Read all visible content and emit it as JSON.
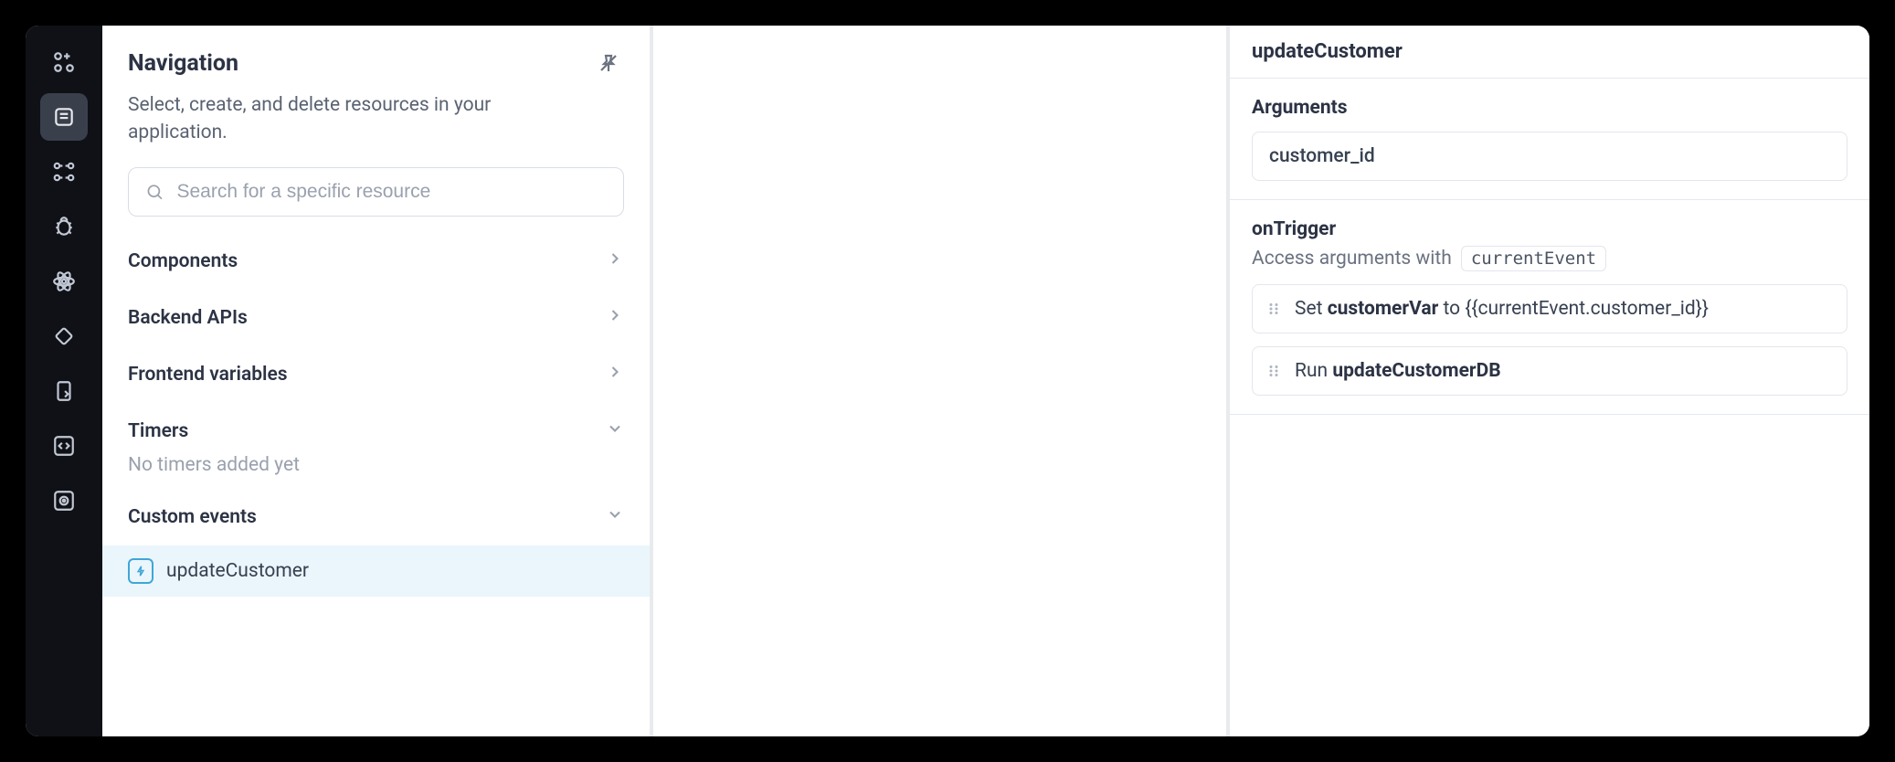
{
  "nav": {
    "title": "Navigation",
    "description": "Select, create, and delete resources in your application.",
    "search_placeholder": "Search for a specific resource",
    "sections": {
      "components": "Components",
      "backend_apis": "Backend APIs",
      "frontend_variables": "Frontend variables",
      "timers": "Timers",
      "timers_empty": "No timers added yet",
      "custom_events": "Custom events"
    },
    "custom_event_item": "updateCustomer"
  },
  "props": {
    "title": "updateCustomer",
    "arguments_heading": "Arguments",
    "argument_name": "customer_id",
    "trigger_heading": "onTrigger",
    "trigger_hint_prefix": "Access arguments with",
    "trigger_hint_code": "currentEvent",
    "action1_verb": "Set ",
    "action1_var": "customerVar",
    "action1_mid": " to ",
    "action1_expr": "{{currentEvent.customer_id}}",
    "action2_verb": "Run ",
    "action2_target": "updateCustomerDB"
  }
}
